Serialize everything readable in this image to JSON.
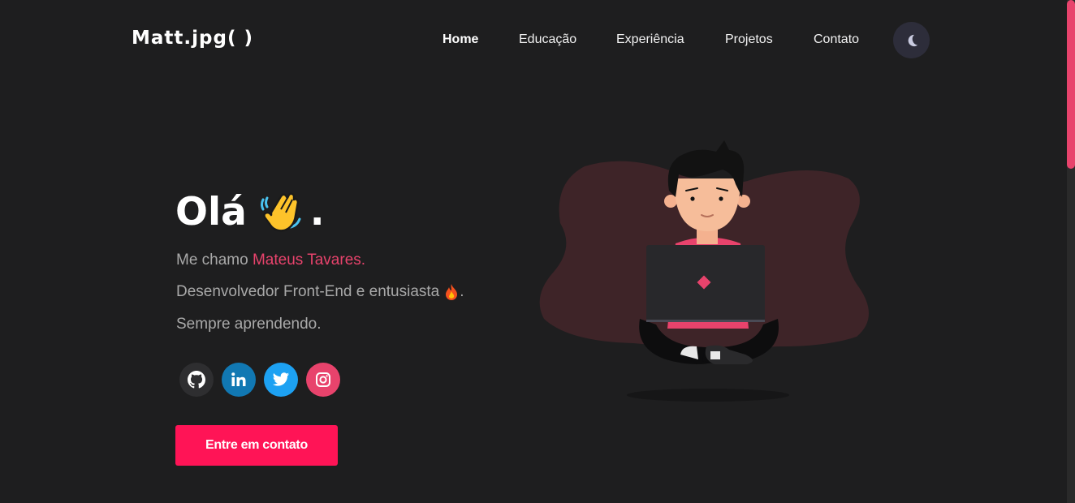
{
  "header": {
    "logo": "Matt.jpg( )",
    "nav": [
      {
        "label": "Home",
        "active": true
      },
      {
        "label": "Educação",
        "active": false
      },
      {
        "label": "Experiência",
        "active": false
      },
      {
        "label": "Projetos",
        "active": false
      },
      {
        "label": "Contato",
        "active": false
      }
    ],
    "theme_toggle_icon": "moon-icon"
  },
  "hero": {
    "greeting": "Olá",
    "greeting_emoji_icon": "waving-hand-icon",
    "greeting_suffix": ".",
    "intro_prefix": "Me chamo ",
    "name": "Mateus Tavares.",
    "role_text": "Desenvolvedor Front-End e entusiasta",
    "role_emoji_icon": "fire-icon",
    "role_suffix": ".",
    "tagline": "Sempre aprendendo.",
    "socials": [
      {
        "icon": "github-icon",
        "color": "#2e2e30"
      },
      {
        "icon": "linkedin-icon",
        "color": "#1178b3"
      },
      {
        "icon": "twitter-icon",
        "color": "#1da1f2"
      },
      {
        "icon": "instagram-icon",
        "color": "#e8436c"
      }
    ],
    "cta_label": "Entre em contato",
    "illustration": "person-with-laptop-illustration"
  },
  "colors": {
    "accent": "#e8436c",
    "cta": "#ff1456",
    "background": "#1e1e1f"
  }
}
